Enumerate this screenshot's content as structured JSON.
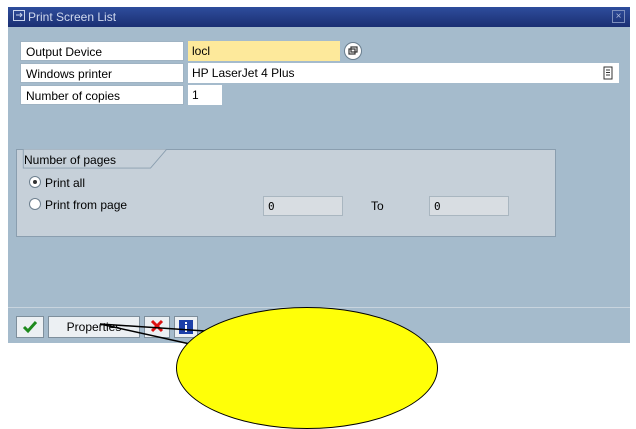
{
  "window": {
    "title": "Print Screen List",
    "title_icon": "print-list-icon",
    "close_icon": "close-icon"
  },
  "form": {
    "output_device_label": "Output Device",
    "output_device_value": "locl",
    "windows_printer_label": "Windows printer",
    "windows_printer_value": "HP LaserJet 4 Plus",
    "copies_label": "Number of copies",
    "copies_value": "1"
  },
  "pages_group": {
    "title": "Number of pages",
    "print_all_label": "Print all",
    "print_all_selected": true,
    "print_from_label": "Print from page",
    "from_value": "0",
    "to_label": "To",
    "to_value": "0"
  },
  "toolbar": {
    "properties_label": "Properties",
    "continue_icon": "checkmark-icon",
    "cancel_icon": "cancel-x-icon",
    "info_icon": "info-icon"
  },
  "colors": {
    "background": "#a5bbcc",
    "title_bar": "#1f3580",
    "focus_field": "#fde99b",
    "group_box": "#c6d0d9",
    "balloon": "#ffff08"
  }
}
